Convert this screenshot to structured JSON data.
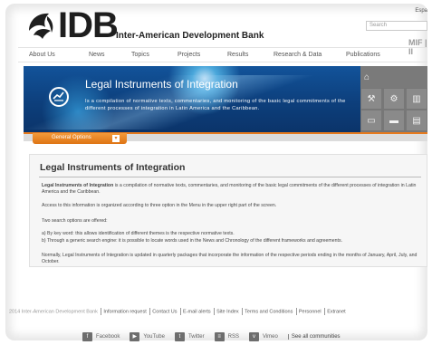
{
  "header": {
    "logo_text": "IDB",
    "org_name": "Inter-American Development Bank",
    "lang_label": "Espa",
    "search_placeholder": "Search",
    "mif_label": "MIF | II"
  },
  "nav": {
    "items": [
      "About Us",
      "News",
      "Topics",
      "Projects",
      "Results",
      "Research & Data",
      "Publications"
    ]
  },
  "banner": {
    "title": "Legal Instruments of Integration",
    "description": "Is a compilation of normative texts, commentaries, and monitoring of the basic legal commitments of the different processes of integration in Latin America and the Caribbean."
  },
  "options": {
    "label": "General Options",
    "caret": "▾"
  },
  "content": {
    "title": "Legal Instruments of Integration",
    "p1_bold": "Legal Instruments of Integration",
    "p1_rest": " is a compilation of normative texts, commentaries, and monitoring of the basic legal commitments of the different processes of integration in Latin America and the Caribbean.",
    "p2": "Access to this information is organized according to three option in the Menu in the upper right part of the screen.",
    "p3": "Two search options are offered:",
    "p4a": "a) By key word: this allows identification of different themes is the respective normative texts.",
    "p4b": "b) Through a generic search engine: it is possible to locate words used in the News and Chronology of the different frameworks and agreements.",
    "p5": "Normally, Legal Instruments of Integration is updated in quarterly packages that incorporate the information of the respective periods ending in the months of January, April, July, and October."
  },
  "footer": {
    "copyright": "2014 Inter-American Development Bank",
    "links": [
      "Information request",
      "Contact Us",
      "E-mail alerts",
      "Site Index",
      "Terms and Conditions",
      "Personnel",
      "Extranet"
    ]
  },
  "social": {
    "items": [
      {
        "label": "Facebook",
        "icon": "f"
      },
      {
        "label": "YouTube",
        "icon": "▶"
      },
      {
        "label": "Twitter",
        "icon": "t"
      },
      {
        "label": "RSS",
        "icon": "≡"
      },
      {
        "label": "Vimeo",
        "icon": "v"
      }
    ],
    "all_label": "See all communities"
  }
}
